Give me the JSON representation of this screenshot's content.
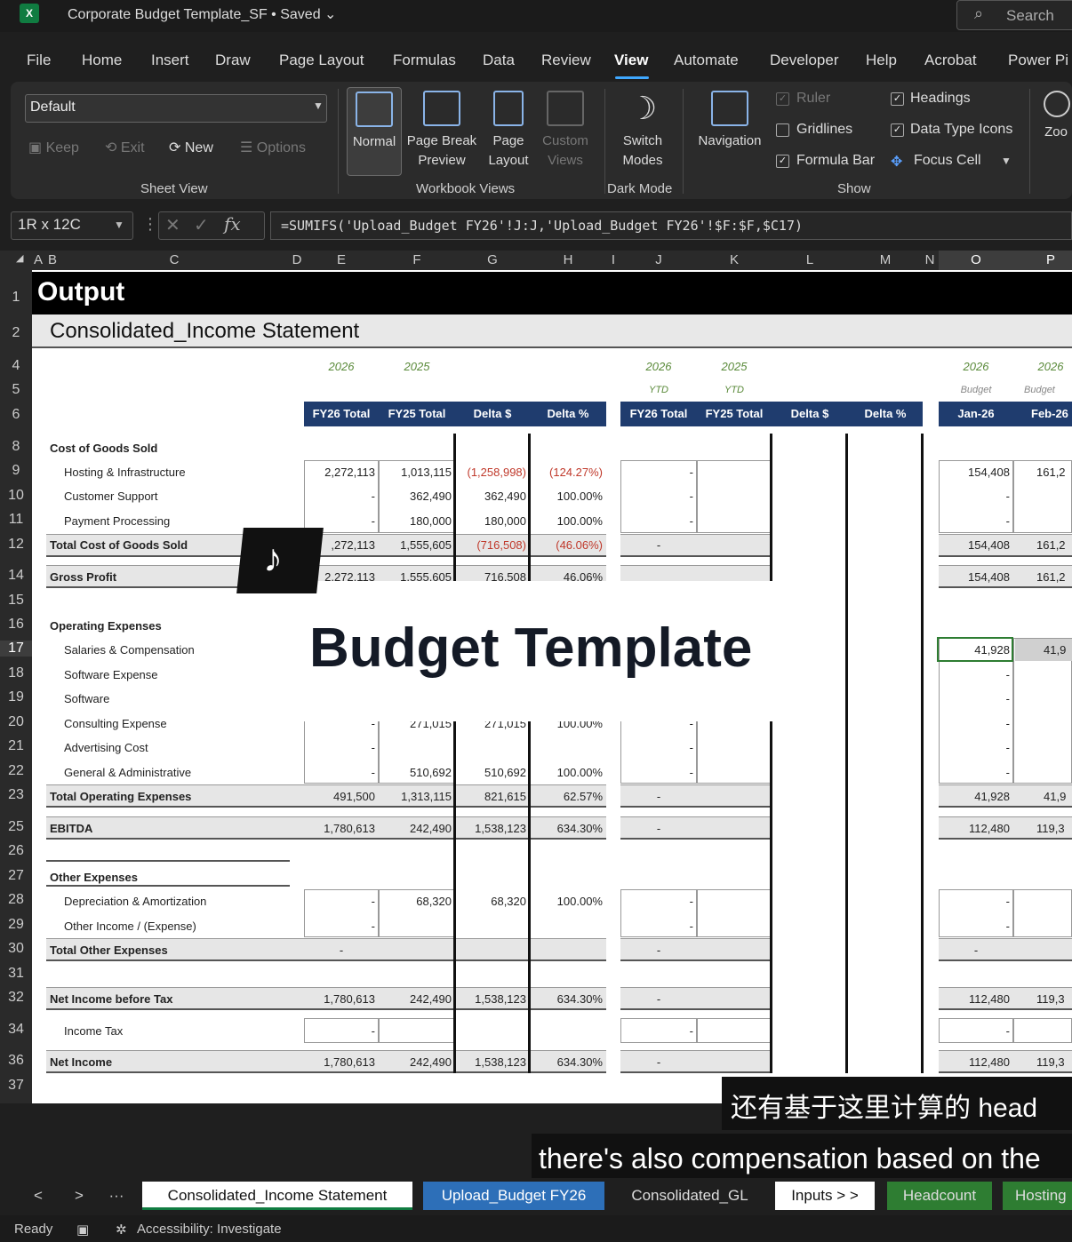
{
  "title_bar": {
    "app_icon_label": "X",
    "doc_title": "Corporate Budget Template_SF • Saved ⌄",
    "search_label": "Search"
  },
  "menu": [
    "File",
    "Home",
    "Insert",
    "Draw",
    "Page Layout",
    "Formulas",
    "Data",
    "Review",
    "View",
    "Automate",
    "Developer",
    "Help",
    "Acrobat",
    "Power Pi"
  ],
  "ribbon": {
    "sheet_view": {
      "select_value": "Default",
      "keep": "Keep",
      "exit": "Exit",
      "new": "New",
      "options": "Options",
      "label": "Sheet View"
    },
    "workbook_views": {
      "normal": "Normal",
      "page_break": "Page Break",
      "page_break2": "Preview",
      "page_layout": "Page",
      "page_layout2": "Layout",
      "custom": "Custom",
      "custom2": "Views",
      "label": "Workbook Views"
    },
    "dark_mode": {
      "switch": "Switch",
      "switch2": "Modes",
      "label": "Dark Mode"
    },
    "navigation": "Navigation",
    "show": {
      "ruler": "Ruler",
      "gridlines": "Gridlines",
      "formula_bar": "Formula Bar",
      "headings": "Headings",
      "data_type_icons": "Data Type Icons",
      "focus_cell": "Focus Cell",
      "label": "Show"
    },
    "zoom": "Zoo"
  },
  "formula_bar": {
    "name_box": "1R x 12C",
    "formula": "=SUMIFS('Upload_Budget FY26'!J:J,'Upload_Budget FY26'!$F:$F,$C17)"
  },
  "columns": [
    "A",
    "B",
    "C",
    "D",
    "E",
    "F",
    "G",
    "H",
    "I",
    "J",
    "K",
    "L",
    "M",
    "N",
    "O",
    "P"
  ],
  "rows": [
    "1",
    "2",
    "4",
    "5",
    "6",
    "8",
    "9",
    "10",
    "11",
    "12",
    "14",
    "15",
    "16",
    "17",
    "18",
    "19",
    "20",
    "21",
    "22",
    "23",
    "25",
    "26",
    "27",
    "28",
    "29",
    "30",
    "31",
    "32",
    "34",
    "36",
    "37"
  ],
  "sheet": {
    "output_title": "Output",
    "section_title": "Consolidated_Income Statement",
    "years": {
      "e": "2026",
      "f": "2025",
      "j": "2026",
      "k": "2025",
      "j_sub": "YTD",
      "k_sub": "YTD",
      "o": "2026",
      "p": "2026",
      "o_sub": "Budget",
      "p_sub": "Budget"
    },
    "headers": {
      "fy26": "FY26 Total",
      "fy25": "FY25 Total",
      "delta_d": "Delta $",
      "delta_p": "Delta %",
      "ytd26": "FY26 Total",
      "ytd25": "FY25 Total",
      "ytd_dd": "Delta $",
      "ytd_dp": "Delta %",
      "jan": "Jan-26",
      "feb": "Feb-26"
    },
    "cogs_title": "Cost of Goods Sold",
    "hosting": {
      "label": "Hosting & Infrastructure",
      "e": "2,272,113",
      "f": "1,013,115",
      "g": "(1,258,998)",
      "h": "(124.27%)",
      "j": "-",
      "o": "154,408",
      "p": "161,2"
    },
    "support": {
      "label": "Customer Support",
      "e": "-",
      "f": "362,490",
      "g": "362,490",
      "h": "100.00%",
      "j": "-",
      "o": "-"
    },
    "payment": {
      "label": "Payment Processing",
      "e": "-",
      "f": "180,000",
      "g": "180,000",
      "h": "100.00%",
      "j": "-",
      "o": "-"
    },
    "total_cogs": {
      "label": "Total Cost of Goods Sold",
      "e": ",272,113",
      "f": "1,555,605",
      "g": "(716,508)",
      "h": "(46.06%)",
      "j": "-",
      "o": "154,408",
      "p": "161,2"
    },
    "gross": {
      "label": "Gross Profit",
      "e": "2,272,113",
      "f": "1,555,605",
      "g": "716,508",
      "h": "46.06%",
      "o": "154,408",
      "p": "161,2"
    },
    "opex_title": "Operating Expenses",
    "salaries": {
      "label": "Salaries & Compensation",
      "o": "41,928",
      "p": "41,9"
    },
    "software_exp": {
      "label": "Software Expense",
      "o": "-"
    },
    "software": {
      "label": "Software",
      "o": "-"
    },
    "consulting": {
      "label": "Consulting Expense",
      "e": "-",
      "f": "271,015",
      "g": "271,015",
      "h": "100.00%",
      "j": "-",
      "o": "-"
    },
    "advertising": {
      "label": "Advertising Cost",
      "e": "-",
      "j": "-",
      "o": "-"
    },
    "gna": {
      "label": "General & Administrative",
      "e": "-",
      "f": "510,692",
      "g": "510,692",
      "h": "100.00%",
      "j": "-",
      "o": "-"
    },
    "total_opex": {
      "label": "Total Operating Expenses",
      "e": "491,500",
      "f": "1,313,115",
      "g": "821,615",
      "h": "62.57%",
      "j": "-",
      "o": "41,928",
      "p": "41,9"
    },
    "ebitda": {
      "label": "EBITDA",
      "e": "1,780,613",
      "f": "242,490",
      "g": "1,538,123",
      "h": "634.30%",
      "j": "-",
      "o": "112,480",
      "p": "119,3"
    },
    "other_title": "Other Expenses",
    "da": {
      "label": "Depreciation & Amortization",
      "e": "-",
      "f": "68,320",
      "g": "68,320",
      "h": "100.00%",
      "j": "-",
      "o": "-"
    },
    "other_inc": {
      "label": "Other Income / (Expense)",
      "e": "-",
      "j": "-",
      "o": "-"
    },
    "total_other": {
      "label": "Total Other Expenses",
      "e": "-",
      "j": "-",
      "o": "-"
    },
    "nibt": {
      "label": "Net Income before Tax",
      "e": "1,780,613",
      "f": "242,490",
      "g": "1,538,123",
      "h": "634.30%",
      "j": "-",
      "o": "112,480",
      "p": "119,3"
    },
    "tax": {
      "label": "Income Tax",
      "e": "-",
      "j": "-",
      "o": "-"
    },
    "net": {
      "label": "Net Income",
      "e": "1,780,613",
      "f": "242,490",
      "g": "1,538,123",
      "h": "634.30%",
      "j": "-",
      "o": "112,480",
      "p": "119,3"
    }
  },
  "overlay": {
    "tiktok_glyph": "♪",
    "title": "Budget Template",
    "subtitle_cn": "还有基于这里计算的 head",
    "subtitle_en": "there's also compensation based on the"
  },
  "tabs": {
    "prev": "<",
    "next": ">",
    "more": "···",
    "t1": "Consolidated_Income Statement",
    "t2": "Upload_Budget FY26",
    "t3": "Consolidated_GL",
    "t4": "Inputs > >",
    "t5": "Headcount",
    "t6": "Hosting"
  },
  "status": {
    "ready": "Ready",
    "accessibility": "Accessibility: Investigate"
  }
}
